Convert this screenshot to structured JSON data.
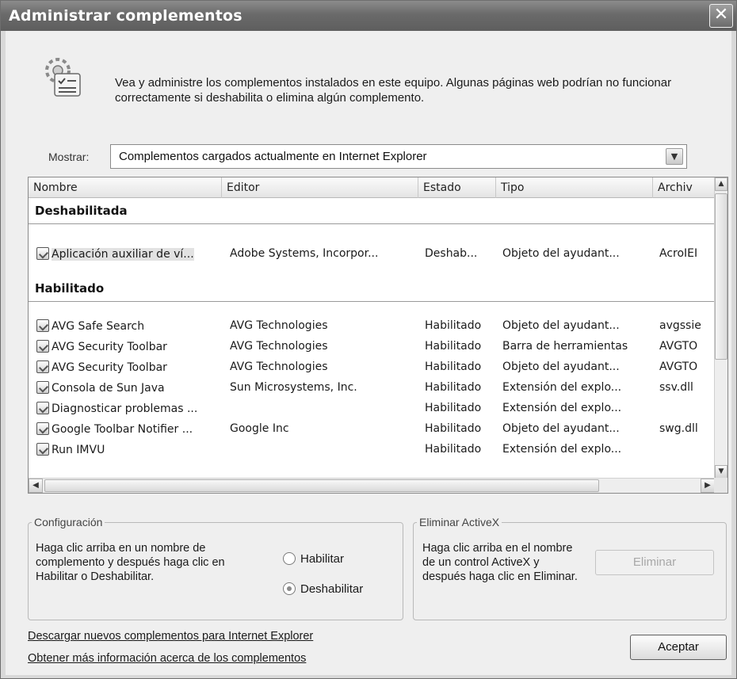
{
  "window": {
    "title": "Administrar complementos",
    "close_glyph": "✕"
  },
  "intro": {
    "icon": "addons-settings-icon",
    "text": "Vea y administre los complementos instalados en este equipo. Algunas páginas web podrían no funcionar correctamente si deshabilita o elimina algún complemento."
  },
  "show": {
    "label": "Mostrar:",
    "value": "Complementos cargados actualmente en Internet Explorer"
  },
  "list": {
    "columns": {
      "name": "Nombre",
      "publisher": "Editor",
      "state": "Estado",
      "type": "Tipo",
      "file": "Archiv"
    },
    "disabled_group": "Deshabilitada",
    "enabled_group": "Habilitado",
    "disabled_rows": [
      {
        "name": "Aplicación auxiliar de ví...",
        "publisher": "Adobe Systems, Incorpor...",
        "state": "Deshab...",
        "type": "Objeto del ayudant...",
        "file": "AcroIEI"
      }
    ],
    "enabled_rows": [
      {
        "name": "AVG Safe Search",
        "publisher": "AVG Technologies",
        "state": "Habilitado",
        "type": "Objeto del ayudant...",
        "file": "avgssie"
      },
      {
        "name": "AVG Security Toolbar",
        "publisher": "AVG Technologies",
        "state": "Habilitado",
        "type": "Barra de herramientas",
        "file": "AVGTO"
      },
      {
        "name": "AVG Security Toolbar",
        "publisher": "AVG Technologies",
        "state": "Habilitado",
        "type": "Objeto del ayudant...",
        "file": "AVGTO"
      },
      {
        "name": "Consola de Sun Java",
        "publisher": "Sun Microsystems, Inc.",
        "state": "Habilitado",
        "type": "Extensión del explo...",
        "file": "ssv.dll"
      },
      {
        "name": "Diagnosticar problemas ...",
        "publisher": "",
        "state": "Habilitado",
        "type": "Extensión del explo...",
        "file": ""
      },
      {
        "name": "Google Toolbar Notifier ...",
        "publisher": "Google Inc",
        "state": "Habilitado",
        "type": "Objeto del ayudant...",
        "file": "swg.dll"
      },
      {
        "name": "Run IMVU",
        "publisher": "",
        "state": "Habilitado",
        "type": "Extensión del explo...",
        "file": ""
      }
    ]
  },
  "config": {
    "legend": "Configuración",
    "text": "Haga clic arriba en un nombre de complemento y después haga clic en Habilitar o Deshabilitar.",
    "enable_label": "Habilitar",
    "disable_label": "Deshabilitar",
    "selected": "Deshabilitar"
  },
  "activex": {
    "legend": "Eliminar ActiveX",
    "text": "Haga clic arriba en el nombre de un control ActiveX y después haga clic en Eliminar.",
    "remove_label": "Eliminar"
  },
  "links": {
    "download": "Descargar nuevos complementos para Internet Explorer",
    "more_info": "Obtener más información acerca de los complementos"
  },
  "ok_label": "Aceptar"
}
